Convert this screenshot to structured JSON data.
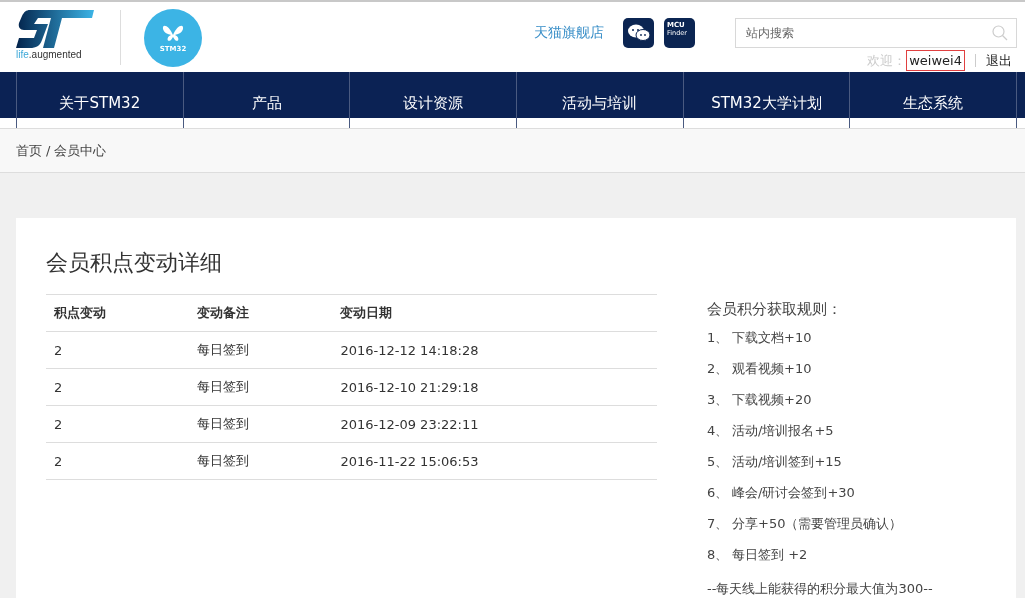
{
  "logo": {
    "tagline_prefix": "life",
    "tagline_suffix": ".augmented",
    "badge": "STM32"
  },
  "header": {
    "store_link": "天猫旗舰店",
    "finder": {
      "line1": "MCU",
      "line2": "Finder"
    },
    "search": {
      "placeholder": "站内搜索"
    },
    "welcome": "欢迎：",
    "username": "weiwei4",
    "username_highlighted": true,
    "logout": "退出"
  },
  "nav": [
    {
      "label": "关于STM32"
    },
    {
      "label": "产品"
    },
    {
      "label": "设计资源"
    },
    {
      "label": "活动与培训"
    },
    {
      "label": "STM32大学计划"
    },
    {
      "label": "生态系统"
    }
  ],
  "breadcrumb": {
    "items": [
      "首页",
      "会员中心"
    ],
    "separator": "/"
  },
  "page_title": "会员积点变动详细",
  "table": {
    "columns": [
      "积点变动",
      "变动备注",
      "变动日期"
    ],
    "rows": [
      [
        "2",
        "每日签到",
        "2016-12-12 14:18:28"
      ],
      [
        "2",
        "每日签到",
        "2016-12-10 21:29:18"
      ],
      [
        "2",
        "每日签到",
        "2016-12-09 23:22:11"
      ],
      [
        "2",
        "每日签到",
        "2016-11-22 15:06:53"
      ]
    ]
  },
  "rules": {
    "title": "会员积分获取规则：",
    "items": [
      {
        "number": "1、",
        "text": "下载文档+10"
      },
      {
        "number": "2、",
        "text": "观看视频+10"
      },
      {
        "number": "3、",
        "text": "下载视频+20"
      },
      {
        "number": "4、",
        "text": "活动/培训报名+5"
      },
      {
        "number": "5、",
        "text": "活动/培训签到+15"
      },
      {
        "number": "6、",
        "text": "峰会/研讨会签到+30"
      },
      {
        "number": "7、",
        "text": "分享+50（需要管理员确认）"
      },
      {
        "number": "8、",
        "text": "每日签到 +2"
      }
    ],
    "footer": "--每天线上能获得的积分最大值为300--"
  }
}
